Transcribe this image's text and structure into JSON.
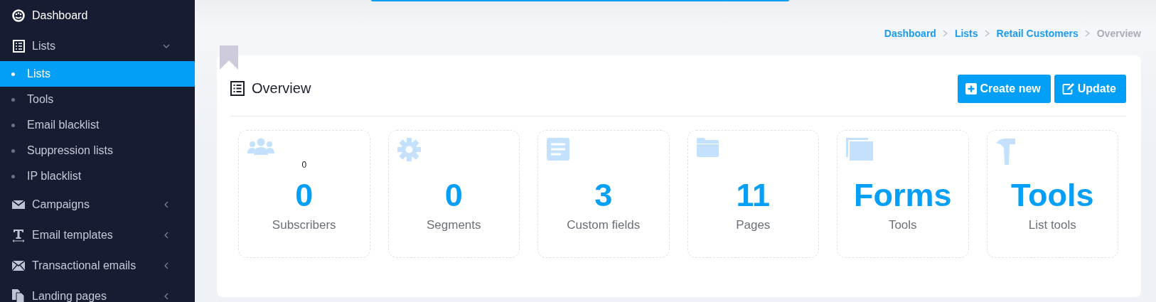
{
  "sidebar": {
    "items": [
      {
        "label": "Dashboard",
        "kind": "link"
      },
      {
        "label": "Lists",
        "kind": "group",
        "expanded": true,
        "children": [
          {
            "label": "Lists",
            "selected": true
          },
          {
            "label": "Tools",
            "selected": false
          },
          {
            "label": "Email blacklist",
            "selected": false
          },
          {
            "label": "Suppression lists",
            "selected": false
          },
          {
            "label": "IP blacklist",
            "selected": false
          }
        ]
      },
      {
        "label": "Campaigns",
        "kind": "group",
        "expanded": false
      },
      {
        "label": "Email templates",
        "kind": "group",
        "expanded": false
      },
      {
        "label": "Transactional emails",
        "kind": "group",
        "expanded": false
      },
      {
        "label": "Landing pages",
        "kind": "group",
        "expanded": false
      }
    ]
  },
  "breadcrumb": [
    {
      "label": "Dashboard",
      "current": false
    },
    {
      "label": "Lists",
      "current": false
    },
    {
      "label": "Retail Customers",
      "current": false
    },
    {
      "label": "Overview",
      "current": true
    }
  ],
  "panel": {
    "title": "Overview",
    "buttons": [
      {
        "label": "Create new"
      },
      {
        "label": "Update"
      }
    ],
    "tiles": [
      {
        "note": "0",
        "value": "0",
        "label": "Subscribers"
      },
      {
        "value": "0",
        "label": "Segments"
      },
      {
        "value": "3",
        "label": "Custom fields"
      },
      {
        "value": "11",
        "label": "Pages"
      },
      {
        "value": "Forms",
        "label": "Tools"
      },
      {
        "value": "Tools",
        "label": "List tools"
      }
    ]
  }
}
